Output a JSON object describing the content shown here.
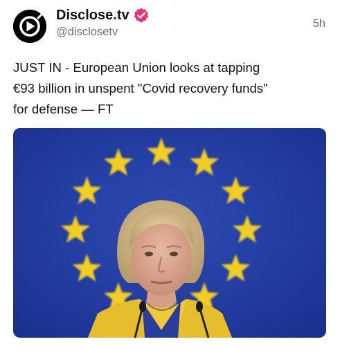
{
  "post": {
    "author": {
      "name": "Disclose.tv",
      "handle": "@disclosetv",
      "avatar_icon": "play-logo-icon",
      "verified_icon": "verified-check-icon",
      "verified_color": "#e8337a"
    },
    "timestamp": "5h",
    "text_lines": [
      "JUST IN - European Union looks at tapping",
      "€93 billion in unspent \"Covid recovery funds\"",
      "for defense — FT"
    ],
    "media": {
      "kind": "photo",
      "description_icons": [
        "eu-flag-stars"
      ],
      "background_color": "#2540a6",
      "star_color": "#f2cd22"
    }
  }
}
